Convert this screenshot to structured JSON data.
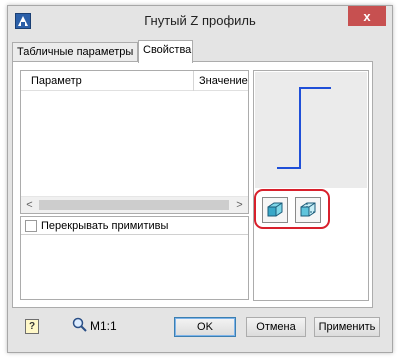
{
  "window": {
    "title": "Гнутый Z профиль",
    "close_glyph": "x"
  },
  "tabs": [
    {
      "label": "Табличные параметры",
      "active": false
    },
    {
      "label": "Свойства",
      "active": true
    }
  ],
  "grid": {
    "columns": [
      "Параметр",
      "Значение"
    ],
    "scroll_left": "<",
    "scroll_right": ">"
  },
  "options": {
    "overlap_primitives": {
      "label": "Перекрывать примитивы",
      "checked": false
    }
  },
  "preview": {
    "profile_color": "#1f4fd8",
    "view_buttons": [
      "3d-cube-view-1-icon",
      "3d-cube-view-2-icon"
    ],
    "highlight_color": "#d8202c"
  },
  "footer": {
    "help_glyph": "?",
    "zoom_label": "M1:1",
    "ok_label": "OK",
    "cancel_label": "Отмена",
    "apply_label": "Применить"
  }
}
